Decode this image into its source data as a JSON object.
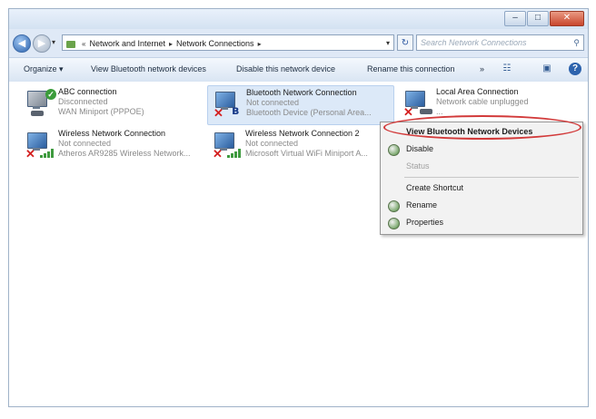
{
  "address": {
    "crumbs": [
      "Network and Internet",
      "Network Connections"
    ],
    "search_placeholder": "Search Network Connections"
  },
  "toolbar": {
    "organize": "Organize ▾",
    "view_bluetooth": "View Bluetooth network devices",
    "disable_device": "Disable this network device",
    "rename": "Rename this connection",
    "more": "»"
  },
  "connections": [
    {
      "name": "ABC connection",
      "status": "Disconnected",
      "device": "WAN Miniport (PPPOE)"
    },
    {
      "name": "Bluetooth Network Connection",
      "status": "Not connected",
      "device": "Bluetooth Device (Personal Area..."
    },
    {
      "name": "Local Area Connection",
      "status": "Network cable unplugged",
      "device": "..."
    },
    {
      "name": "Wireless Network Connection",
      "status": "Not connected",
      "device": "Atheros AR9285 Wireless Network..."
    },
    {
      "name": "Wireless Network Connection 2",
      "status": "Not connected",
      "device": "Microsoft Virtual WiFi Miniport A..."
    }
  ],
  "context_menu": {
    "items": [
      "View Bluetooth Network Devices",
      "Disable",
      "Status",
      "Create Shortcut",
      "Rename",
      "Properties"
    ]
  }
}
